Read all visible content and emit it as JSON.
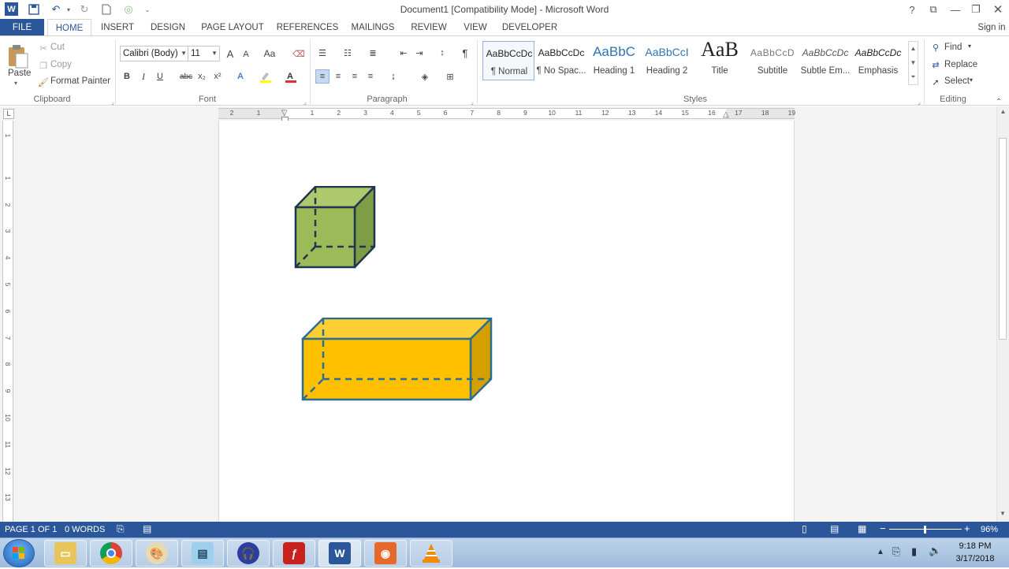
{
  "window": {
    "title": "Document1 [Compatibility Mode] - Microsoft Word",
    "sign_in": "Sign in"
  },
  "tabs": [
    "FILE",
    "HOME",
    "INSERT",
    "DESIGN",
    "PAGE LAYOUT",
    "REFERENCES",
    "MAILINGS",
    "REVIEW",
    "VIEW",
    "DEVELOPER"
  ],
  "clipboard": {
    "paste": "Paste",
    "cut": "Cut",
    "copy": "Copy",
    "format_painter": "Format Painter",
    "label": "Clipboard"
  },
  "font": {
    "family": "Calibri (Body)",
    "size": "11",
    "label": "Font",
    "bold": "B",
    "italic": "I",
    "underline": "U",
    "strike": "abc",
    "sub": "x₂",
    "sup": "x²",
    "grow": "A",
    "shrink": "A",
    "case": "Aa"
  },
  "paragraph": {
    "label": "Paragraph",
    "pilcrow": "¶"
  },
  "styles": {
    "label": "Styles",
    "items": [
      {
        "preview": "AaBbCcDc",
        "name": "¶ Normal"
      },
      {
        "preview": "AaBbCcDc",
        "name": "¶ No Spac..."
      },
      {
        "preview": "AaBbC",
        "name": "Heading 1"
      },
      {
        "preview": "AaBbCcI",
        "name": "Heading 2"
      },
      {
        "preview": "AaB",
        "name": "Title"
      },
      {
        "preview": "AaBbCcD",
        "name": "Subtitle"
      },
      {
        "preview": "AaBbCcDc",
        "name": "Subtle Em..."
      },
      {
        "preview": "AaBbCcDc",
        "name": "Emphasis"
      }
    ]
  },
  "editing": {
    "find": "Find",
    "replace": "Replace",
    "select": "Select",
    "label": "Editing"
  },
  "ruler": {
    "left_marks": [
      "2",
      "1"
    ],
    "right_marks": [
      "1",
      "2",
      "3",
      "4",
      "5",
      "6",
      "7",
      "8",
      "9",
      "10",
      "11",
      "12",
      "13",
      "14",
      "15",
      "16",
      "17",
      "18",
      "19"
    ],
    "vertical_marks": [
      "1",
      "1",
      "2",
      "3",
      "4",
      "5",
      "6",
      "7",
      "8",
      "9",
      "10",
      "11",
      "12",
      "13"
    ]
  },
  "shapes": {
    "cube": {
      "fill": "#9bbb59",
      "side": "#7f9d44",
      "top": "#adc96c",
      "stroke": "#1f3550"
    },
    "cuboid": {
      "fill": "#ffc000",
      "side": "#d4a000",
      "top": "#ffce33",
      "stroke": "#2c6e8f"
    }
  },
  "status": {
    "page": "PAGE 1 OF 1",
    "words": "0 WORDS",
    "zoom": "96%",
    "zoom_level": 0.48
  },
  "taskbar": {
    "time": "9:18 PM",
    "date": "3/17/2018"
  },
  "colors": {
    "accent": "#2b579a"
  }
}
